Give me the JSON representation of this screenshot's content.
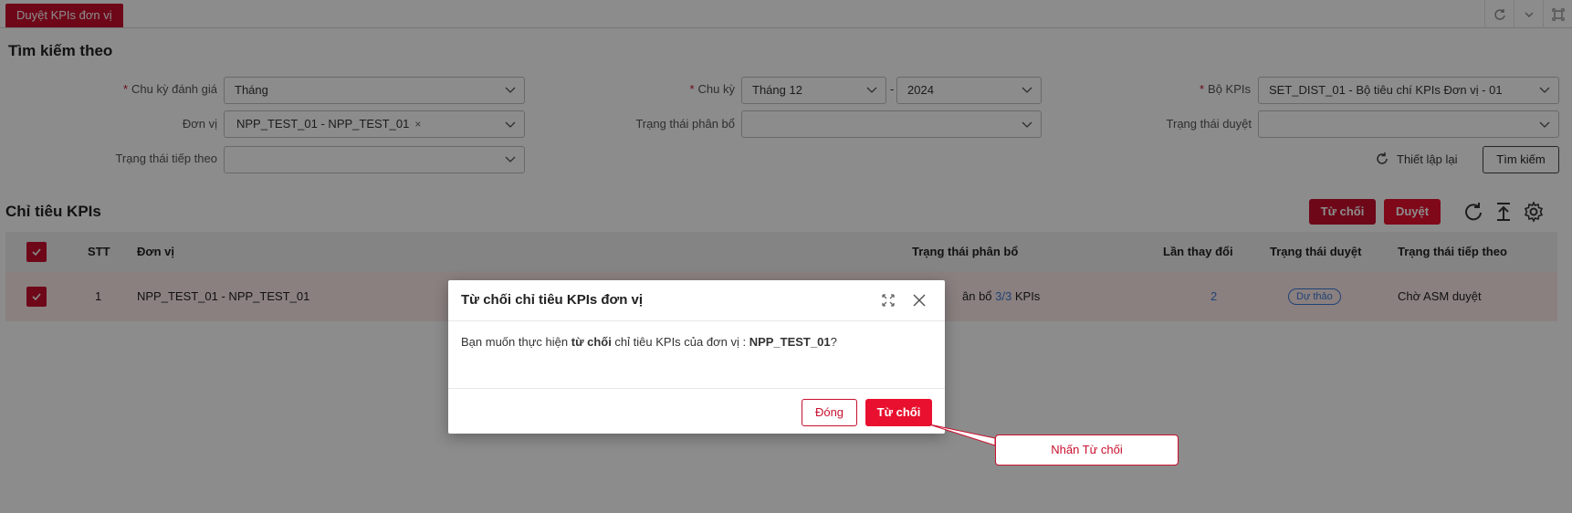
{
  "tab": {
    "label": "Duyệt KPIs đơn vị"
  },
  "search": {
    "title": "Tìm kiếm theo",
    "fields": {
      "chu_ky_danh_gia": {
        "label": "Chu kỳ đánh giá",
        "value": "Tháng"
      },
      "chu_ky": {
        "label": "Chu kỳ",
        "month": "Tháng 12",
        "separator": "-",
        "year": "2024"
      },
      "bo_kpis": {
        "label": "Bộ KPIs",
        "value": "SET_DIST_01 - Bộ tiêu chí KPIs Đơn vị - 01"
      },
      "don_vi": {
        "label": "Đơn vị",
        "tag": "NPP_TEST_01 - NPP_TEST_01",
        "tag_remove": "×"
      },
      "trang_thai_phan_bo": {
        "label": "Trạng thái phân bổ",
        "value": ""
      },
      "trang_thai_duyet": {
        "label": "Trạng thái duyệt",
        "value": ""
      },
      "trang_thai_tiep_theo": {
        "label": "Trạng thái tiếp theo",
        "value": ""
      }
    },
    "reset_label": "Thiết lập lại",
    "search_label": "Tìm kiếm"
  },
  "kpis": {
    "title": "Chỉ tiêu KPIs",
    "reject_label": "Từ chối",
    "approve_label": "Duyệt",
    "columns": {
      "stt": "STT",
      "don_vi": "Đơn vị",
      "trang_thai_phan_bo": "Trạng thái phân bổ",
      "lan_thay_doi": "Lần thay đổi",
      "trang_thai_duyet": "Trạng thái duyệt",
      "trang_thai_tiep_theo": "Trạng thái tiếp theo"
    },
    "rows": [
      {
        "stt": "1",
        "don_vi": "NPP_TEST_01 - NPP_TEST_01",
        "phan_bo_prefix": "ân bổ ",
        "phan_bo_count": "3/3",
        "phan_bo_suffix": " KPIs",
        "lan_thay_doi": "2",
        "trang_thai_duyet": "Dự thảo",
        "trang_thai_tiep_theo": "Chờ ASM duyệt"
      }
    ]
  },
  "modal": {
    "title": "Từ chối chỉ tiêu KPIs đơn vị",
    "body_prefix": "Bạn muốn thực hiện ",
    "body_bold": "từ chối",
    "body_middle": " chỉ tiêu KPIs của đơn vị : ",
    "body_unit": "NPP_TEST_01",
    "body_suffix": "?",
    "close_label": "Đóng",
    "reject_label": "Từ chối"
  },
  "callout": {
    "text": "Nhấn Từ chối"
  },
  "colors": {
    "brand": "#c8102e",
    "link": "#3a7bd5"
  }
}
